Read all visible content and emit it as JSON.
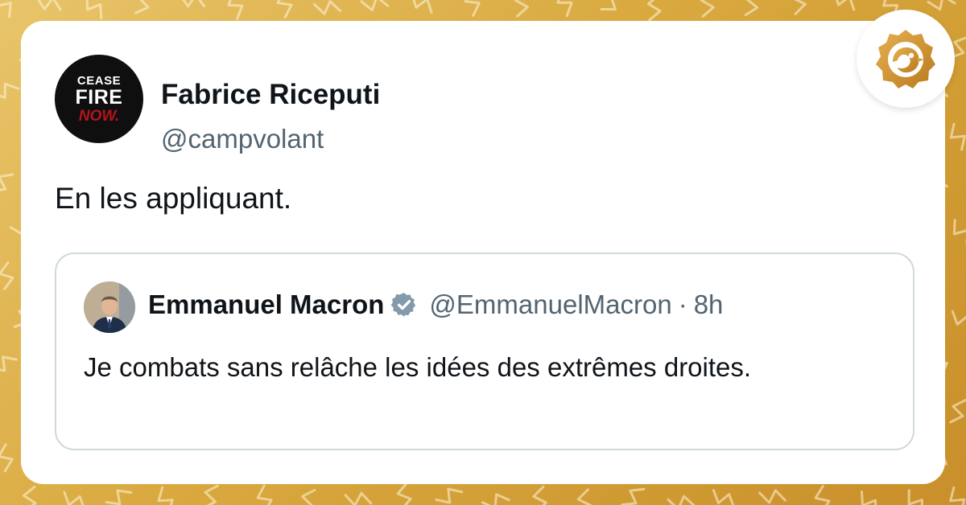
{
  "tweet": {
    "author_name": "Fabrice Riceputi",
    "author_handle": "@campvolant",
    "avatar_text": [
      "CEASE",
      "FIRE",
      "NOW."
    ],
    "text": "En les appliquant."
  },
  "quoted_tweet": {
    "author_name": "Emmanuel Macron",
    "verified": true,
    "author_handle": "@EmmanuelMacron",
    "separator": "·",
    "time": "8h",
    "text": "Je combats sans relâche les idées des extrêmes droites."
  },
  "colors": {
    "background_gold": "#d9a93f",
    "text_primary": "#0f1419",
    "text_secondary": "#536471",
    "verified_blue_gray": "#829aab",
    "border": "#cfd9de"
  },
  "icons": {
    "verified": "verified-badge-icon",
    "brand_logo": "bird-logo-icon"
  }
}
